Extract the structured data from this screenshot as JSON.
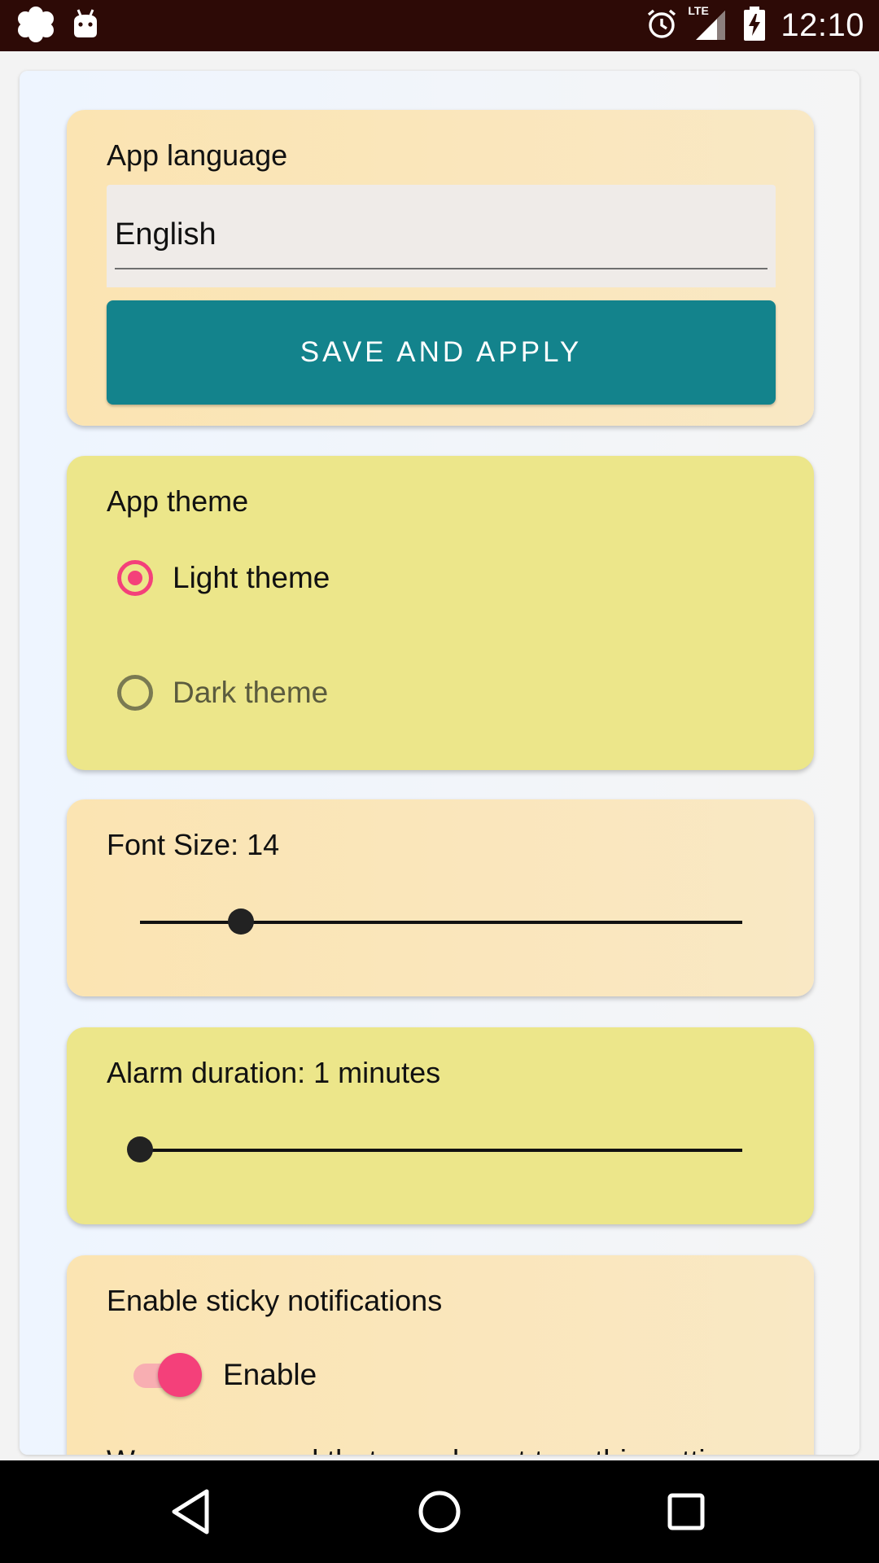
{
  "status_bar": {
    "time": "12:10",
    "network": "LTE",
    "icons": [
      "app-icon",
      "android-icon",
      "alarm-icon",
      "signal-icon",
      "battery-charging-icon"
    ],
    "background": "#2d0a06"
  },
  "language_card": {
    "title": "App language",
    "selected_language": "English",
    "save_button_label": "SAVE AND APPLY",
    "button_color": "#13838c"
  },
  "theme_card": {
    "title": "App theme",
    "options": [
      {
        "label": "Light theme",
        "selected": true
      },
      {
        "label": "Dark theme",
        "selected": false
      }
    ],
    "accent": "#f4407a"
  },
  "font_card": {
    "title": "Font Size: 14",
    "slider_fraction": 0.167
  },
  "alarm_card": {
    "title": "Alarm duration: 1 minutes",
    "slider_fraction": 0.0
  },
  "notify_card": {
    "title": "Enable sticky notifications",
    "toggle_label": "Enable",
    "toggle_on": true,
    "note": "We recommend that you do not turn this setting"
  },
  "nav_bar": {
    "icons": [
      "back-icon",
      "home-icon",
      "recents-icon"
    ]
  }
}
